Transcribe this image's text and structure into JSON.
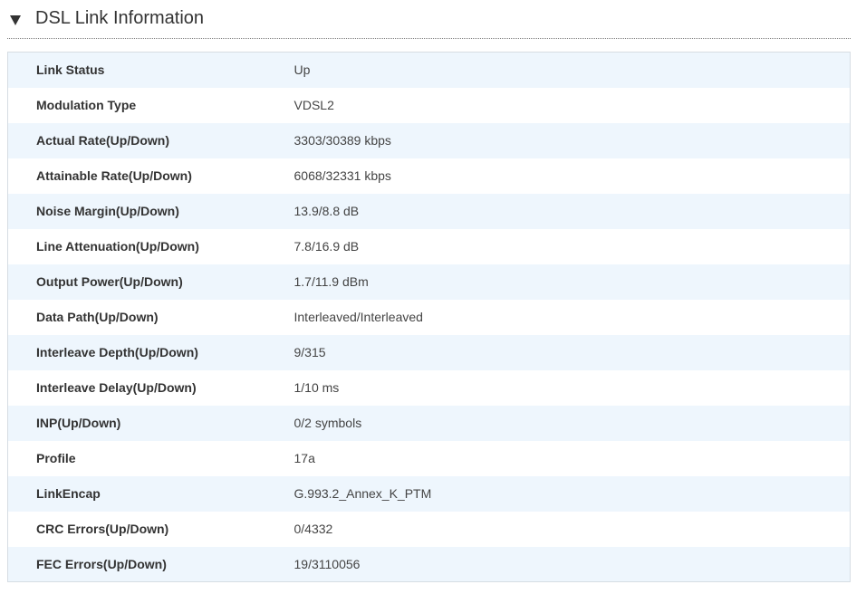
{
  "section": {
    "title": "DSL Link Information",
    "toggle_icon": "triangle-down-icon"
  },
  "rows": [
    {
      "label": "Link Status",
      "value": "Up"
    },
    {
      "label": "Modulation Type",
      "value": "VDSL2"
    },
    {
      "label": "Actual Rate(Up/Down)",
      "value": "3303/30389 kbps"
    },
    {
      "label": "Attainable Rate(Up/Down)",
      "value": "6068/32331 kbps"
    },
    {
      "label": "Noise Margin(Up/Down)",
      "value": "13.9/8.8 dB"
    },
    {
      "label": "Line Attenuation(Up/Down)",
      "value": "7.8/16.9 dB"
    },
    {
      "label": "Output Power(Up/Down)",
      "value": "1.7/11.9 dBm"
    },
    {
      "label": "Data Path(Up/Down)",
      "value": "Interleaved/Interleaved"
    },
    {
      "label": "Interleave Depth(Up/Down)",
      "value": "9/315"
    },
    {
      "label": "Interleave Delay(Up/Down)",
      "value": "1/10 ms"
    },
    {
      "label": "INP(Up/Down)",
      "value": "0/2 symbols"
    },
    {
      "label": "Profile",
      "value": "17a"
    },
    {
      "label": "LinkEncap",
      "value": "G.993.2_Annex_K_PTM"
    },
    {
      "label": "CRC Errors(Up/Down)",
      "value": "0/4332"
    },
    {
      "label": "FEC Errors(Up/Down)",
      "value": "19/3110056"
    }
  ],
  "colors": {
    "row_alt": "#eef6fd",
    "row": "#ffffff",
    "border": "#d6dde3",
    "text": "#333333"
  }
}
